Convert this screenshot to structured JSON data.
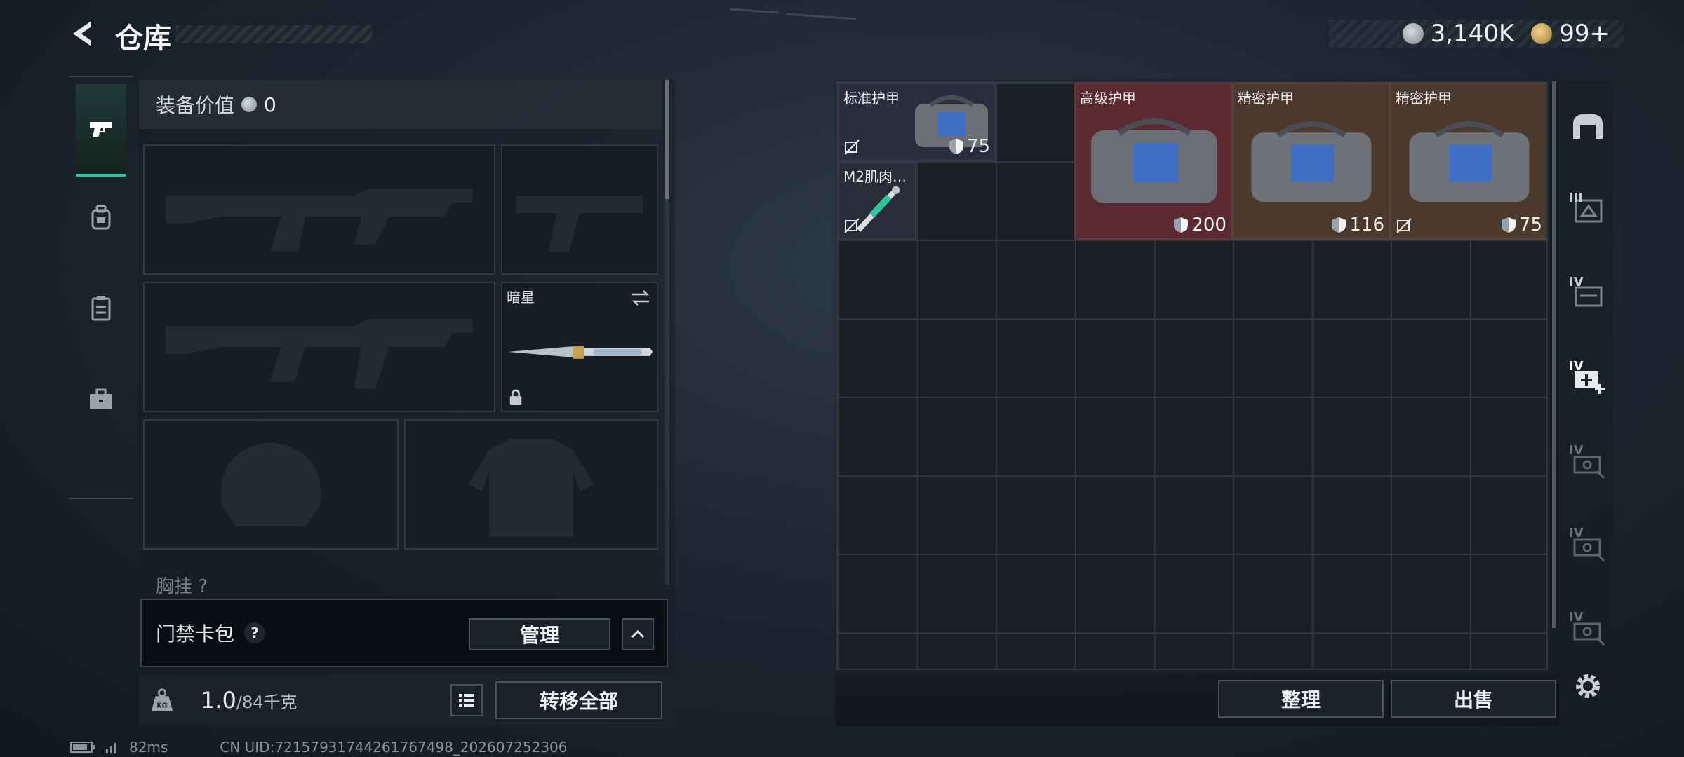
{
  "header": {
    "title": "仓库",
    "currency_silver": "3,140K",
    "currency_gold": "99+"
  },
  "tabs": [
    {
      "name": "weapons",
      "icon": "pistol-icon",
      "active": true
    },
    {
      "name": "gear",
      "icon": "backpack-icon",
      "active": false
    },
    {
      "name": "consumables",
      "icon": "clipboard-icon",
      "active": false
    },
    {
      "name": "case",
      "icon": "briefcase-icon",
      "active": false
    }
  ],
  "equipment": {
    "value_label": "装备价值",
    "value": "0",
    "melee_name": "暗星",
    "chest_label": "胸挂 ?",
    "card_bag_label": "门禁卡包",
    "manage_label": "管理",
    "weight_value": "1.0",
    "weight_max": "/84千克",
    "weight_icon_text": "KG",
    "transfer_all_label": "转移全部"
  },
  "inventory": {
    "items": [
      {
        "name": "标准护甲",
        "durability": "75",
        "color": "#2b2d3f"
      },
      {
        "name": "M2肌肉…",
        "durability": "",
        "color": "#2a2c3a"
      },
      {
        "name": "高级护甲",
        "durability": "200",
        "color": "#5a2a30"
      },
      {
        "name": "精密护甲",
        "durability": "116",
        "color": "#4b3a2c"
      },
      {
        "name": "精密护甲",
        "durability": "75",
        "color": "#4b3a2c"
      }
    ],
    "sort_label": "整理",
    "sell_label": "出售"
  },
  "side_tiers": [
    "III",
    "IV",
    "IV",
    "IV",
    "IV",
    "IV"
  ],
  "status": {
    "ping": "82ms",
    "uid": "CN UID:7215793174426176749​8_202607252306"
  }
}
